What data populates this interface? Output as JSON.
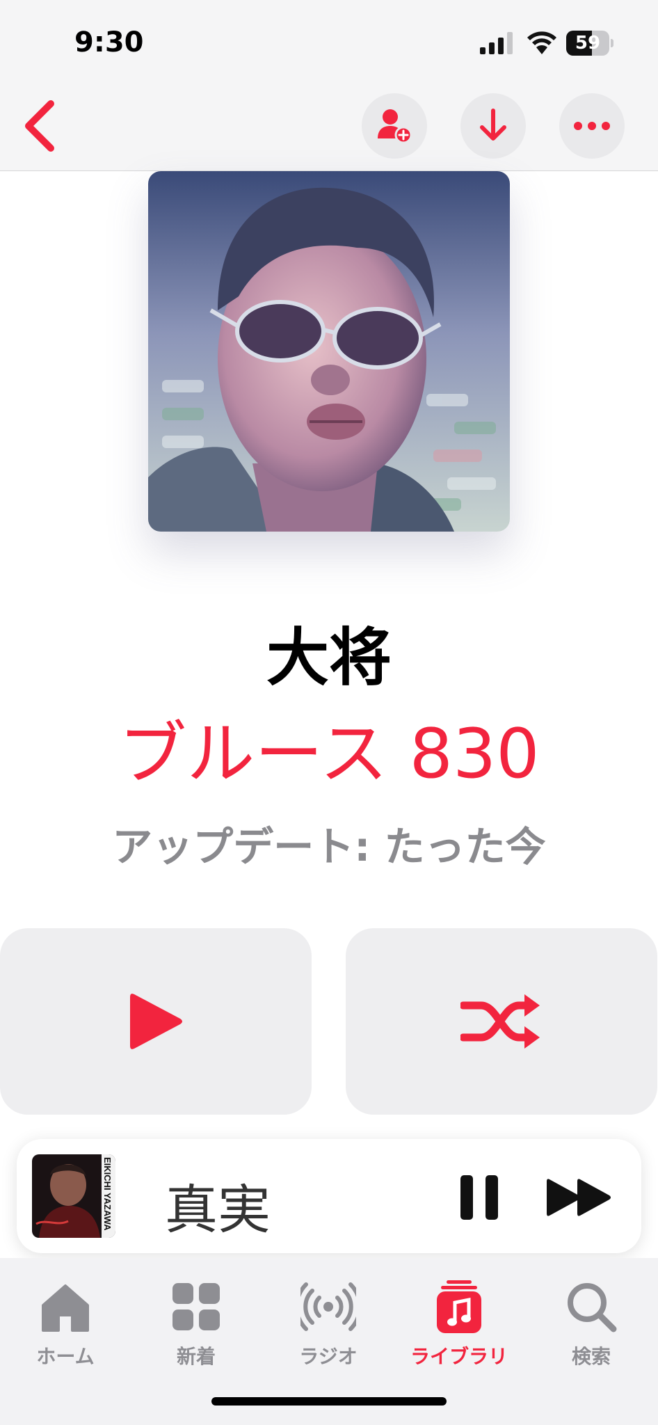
{
  "status_bar": {
    "time": "9:30",
    "battery_level": "59",
    "battery_fraction": 0.59
  },
  "nav": {
    "back_icon": "chevron-left-icon",
    "actions": [
      "add-user-icon",
      "download-arrow-icon",
      "more-ellipsis-icon"
    ]
  },
  "playlist": {
    "name": "大将",
    "curator": "ブルース 830",
    "updated": "アップデート: たった今"
  },
  "controls": {
    "play_icon": "play-icon",
    "shuffle_icon": "shuffle-icon"
  },
  "mini_player": {
    "track_title": "真実",
    "artwork_text": "EIKICHI YAZAWA"
  },
  "tabs": [
    {
      "label": "ホーム",
      "icon": "house-icon",
      "active": false
    },
    {
      "label": "新着",
      "icon": "grid-icon",
      "active": false
    },
    {
      "label": "ラジオ",
      "icon": "radio-waves-icon",
      "active": false
    },
    {
      "label": "ライブラリ",
      "icon": "music-note-stack-icon",
      "active": true
    },
    {
      "label": "検索",
      "icon": "magnifier-icon",
      "active": false
    }
  ],
  "colors": {
    "accent": "#f2243e",
    "secondary_text": "#8a8a8e",
    "button_bg": "#eeeef0"
  }
}
